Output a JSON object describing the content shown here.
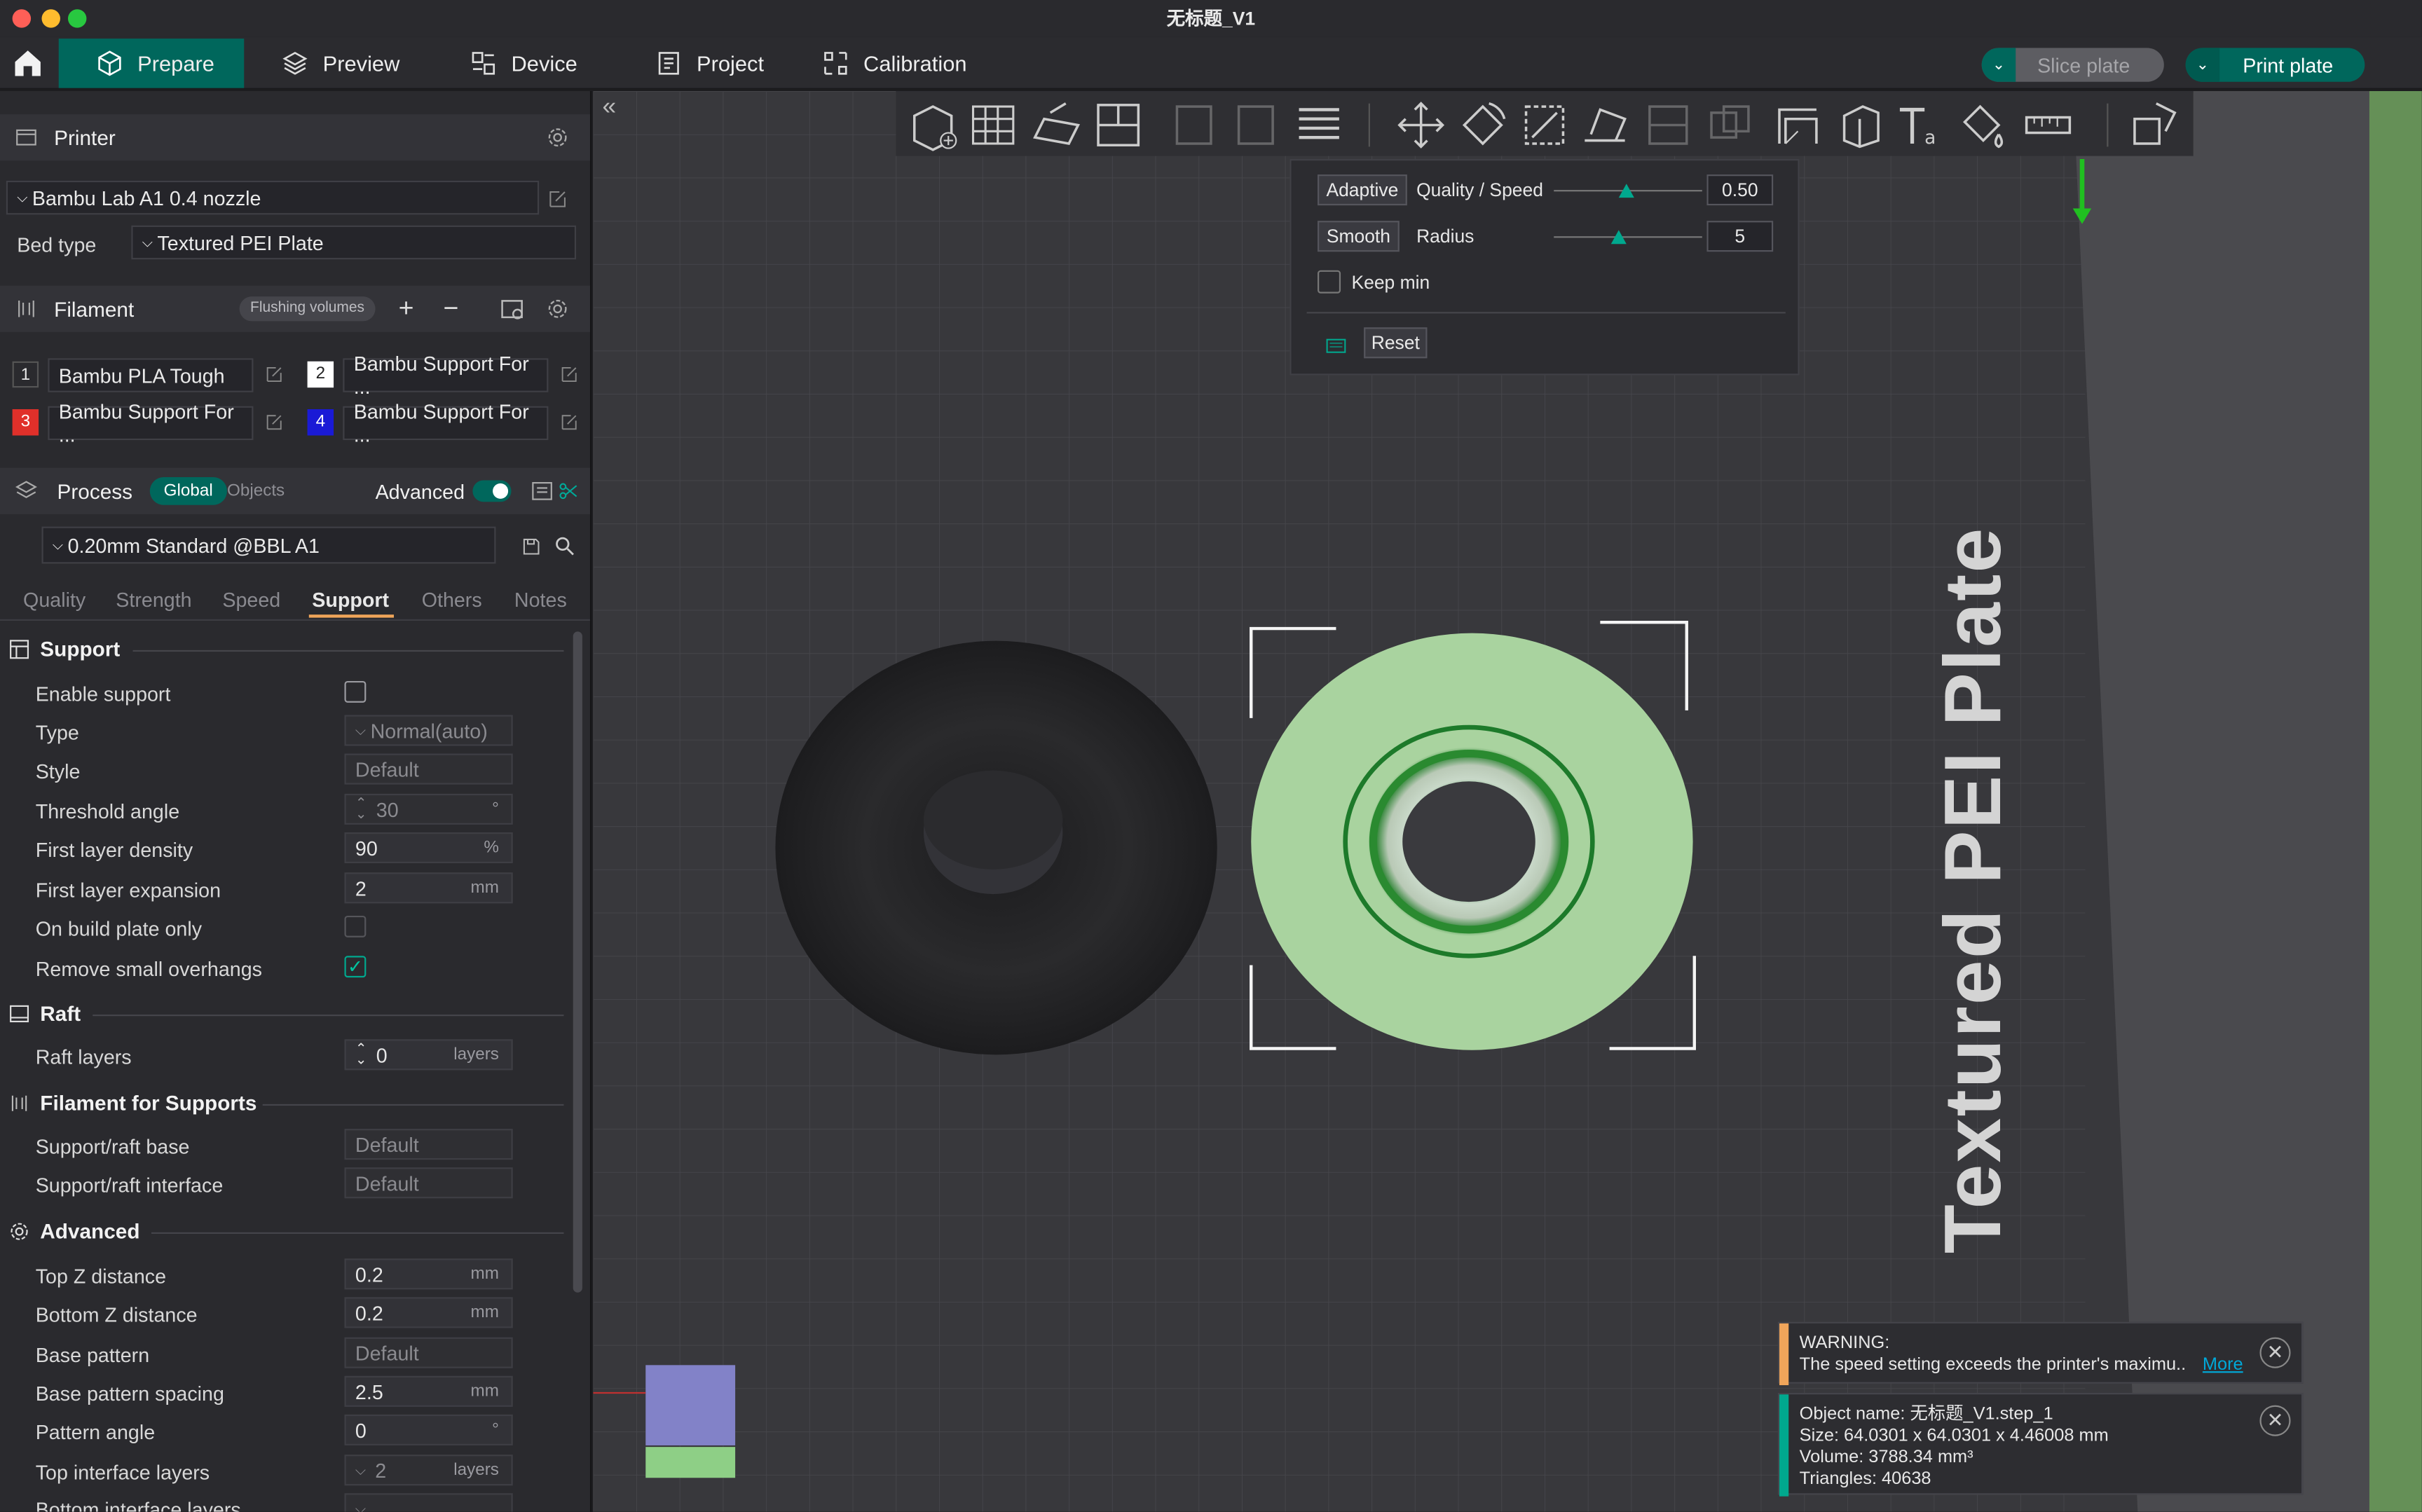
{
  "window": {
    "title": "无标题_V1"
  },
  "nav": {
    "tabs": [
      {
        "label": "Prepare"
      },
      {
        "label": "Preview"
      },
      {
        "label": "Device"
      },
      {
        "label": "Project"
      },
      {
        "label": "Calibration"
      }
    ],
    "slice_label": "Slice plate",
    "print_label": "Print plate"
  },
  "printer": {
    "header": "Printer",
    "name": "Bambu Lab A1 0.4 nozzle",
    "bed_type_label": "Bed type",
    "bed_type_value": "Textured PEI Plate"
  },
  "filament": {
    "header": "Filament",
    "flushing_label": "Flushing volumes",
    "items": [
      {
        "index": "1",
        "name": "Bambu PLA Tough",
        "color": "#2a2a2e",
        "num_color": "#ffffff"
      },
      {
        "index": "2",
        "name": "Bambu Support For ...",
        "color": "#ffffff",
        "num_color": "#222222"
      },
      {
        "index": "3",
        "name": "Bambu Support For ...",
        "color": "#e0302a",
        "num_color": "#ffffff"
      },
      {
        "index": "4",
        "name": "Bambu Support For ...",
        "color": "#1a1ad6",
        "num_color": "#ffffff"
      }
    ]
  },
  "process": {
    "header": "Process",
    "global_label": "Global",
    "objects_label": "Objects",
    "advanced_label": "Advanced",
    "advanced_on": true,
    "preset": "0.20mm Standard @BBL A1",
    "tabs": [
      "Quality",
      "Strength",
      "Speed",
      "Support",
      "Others",
      "Notes"
    ],
    "active_tab": "Support"
  },
  "support": {
    "title": "Support",
    "enable_label": "Enable support",
    "enable_checked": false,
    "type_label": "Type",
    "type_value": "Normal(auto)",
    "style_label": "Style",
    "style_value": "Default",
    "threshold_label": "Threshold angle",
    "threshold_value": "30",
    "threshold_unit": "°",
    "density_label": "First layer density",
    "density_value": "90",
    "density_unit": "%",
    "expansion_label": "First layer expansion",
    "expansion_value": "2",
    "expansion_unit": "mm",
    "buildplate_label": "On build plate only",
    "buildplate_checked": false,
    "overhangs_label": "Remove small overhangs",
    "overhangs_checked": true
  },
  "raft": {
    "title": "Raft",
    "layers_label": "Raft layers",
    "layers_value": "0",
    "layers_unit": "layers"
  },
  "filament_supports": {
    "title": "Filament for Supports",
    "base_label": "Support/raft base",
    "base_value": "Default",
    "interface_label": "Support/raft interface",
    "interface_value": "Default"
  },
  "advanced": {
    "title": "Advanced",
    "topz_label": "Top Z distance",
    "topz_value": "0.2",
    "topz_unit": "mm",
    "bottomz_label": "Bottom Z distance",
    "bottomz_value": "0.2",
    "bottomz_unit": "mm",
    "pattern_label": "Base pattern",
    "pattern_value": "Default",
    "spacing_label": "Base pattern spacing",
    "spacing_value": "2.5",
    "spacing_unit": "mm",
    "angle_label": "Pattern angle",
    "angle_value": "0",
    "angle_unit": "°",
    "topif_label": "Top interface layers",
    "topif_value": "2",
    "topif_unit": "layers",
    "bottomif_label": "Bottom interface layers"
  },
  "variable_layer": {
    "adaptive_label": "Adaptive",
    "quality_label": "Quality / Speed",
    "quality_value": "0.50",
    "smooth_label": "Smooth",
    "radius_label": "Radius",
    "radius_value": "5",
    "keepmin_label": "Keep min",
    "reset_label": "Reset"
  },
  "plate": {
    "label": "Textured PEI Plate"
  },
  "warning": {
    "title": "WARNING:",
    "message": "The speed setting exceeds the printer's maximu..",
    "more_label": "More"
  },
  "object_info": {
    "name_line": "Object name: 无标题_V1.step_1",
    "size_line": "Size: 64.0301 x 64.0301 x 4.46008 mm",
    "volume_line": "Volume: 3788.34 mm³",
    "triangles_line": "Triangles: 40638"
  },
  "colors": {
    "accent": "#00675c",
    "accent_light": "#00a88e",
    "warning": "#f0a55a"
  }
}
